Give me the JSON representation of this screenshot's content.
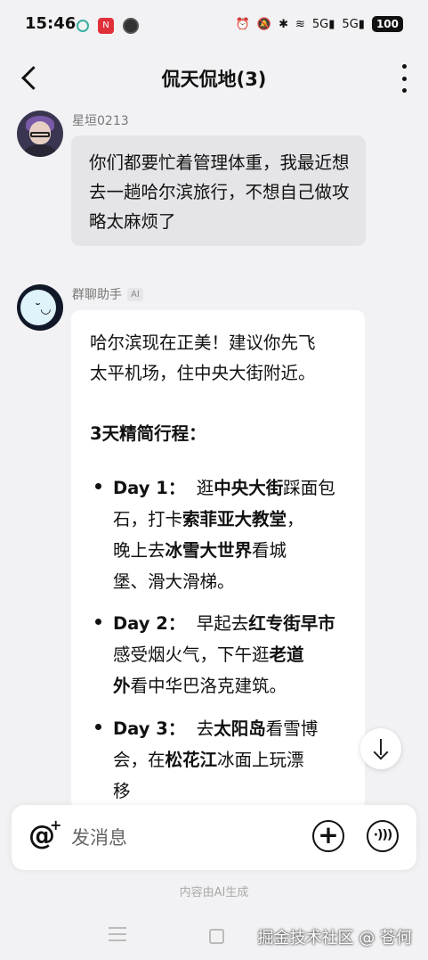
{
  "status_bar": {
    "time": "15:46",
    "app_badge": "N",
    "signal1": "5G",
    "signal2": "5G",
    "battery": "100"
  },
  "header": {
    "title": "侃天侃地(3)"
  },
  "messages": [
    {
      "sender": "星垣0213",
      "text": "你们都要忙着管理体重，我最近想去一趟哈尔滨旅行，不想自己做攻略太麻烦了"
    },
    {
      "sender": "群聊助手",
      "badge": "AI",
      "intro1": "哈尔滨现在正美！建议你先飞",
      "intro2": "太平机场，住中央大街附近。",
      "plan_title": "3天精简行程：",
      "days": [
        {
          "label": "Day 1：",
          "l1_a": "逛",
          "l1_b": "中央大街",
          "l1_c": "踩面包",
          "l2_a": "石，打卡",
          "l2_b": "索菲亚大教堂",
          "l2_c": "，",
          "l3_a": "晚上去",
          "l3_b": "冰雪大世界",
          "l3_c": "看城",
          "l4_a": "堡、滑大滑梯。"
        },
        {
          "label": "Day 2：",
          "l1_a": "早起去",
          "l1_b": "红专街早市",
          "l2_a": "感受烟火气，下午逛",
          "l2_b": "老道",
          "l3_a": "外",
          "l3_b": "看中华巴洛克建筑。"
        },
        {
          "label": "Day 3：",
          "l1_a": "去",
          "l1_b": "太阳岛",
          "l1_c": "看雪博",
          "l2_a": "会，在",
          "l2_b": "松花江",
          "l2_c": "冰面上玩漂",
          "l3_a": "移"
        }
      ]
    }
  ],
  "input": {
    "placeholder": "发消息"
  },
  "disclaimer": "内容由AI生成",
  "watermark": "掘金技术社区 @ 苍何",
  "icons": {
    "back": "back-arrow-icon",
    "more": "more-vertical-icon",
    "mention": "at-plus-icon",
    "add": "plus-circle-icon",
    "voice": "voice-circle-icon",
    "scroll": "arrow-down-icon"
  }
}
